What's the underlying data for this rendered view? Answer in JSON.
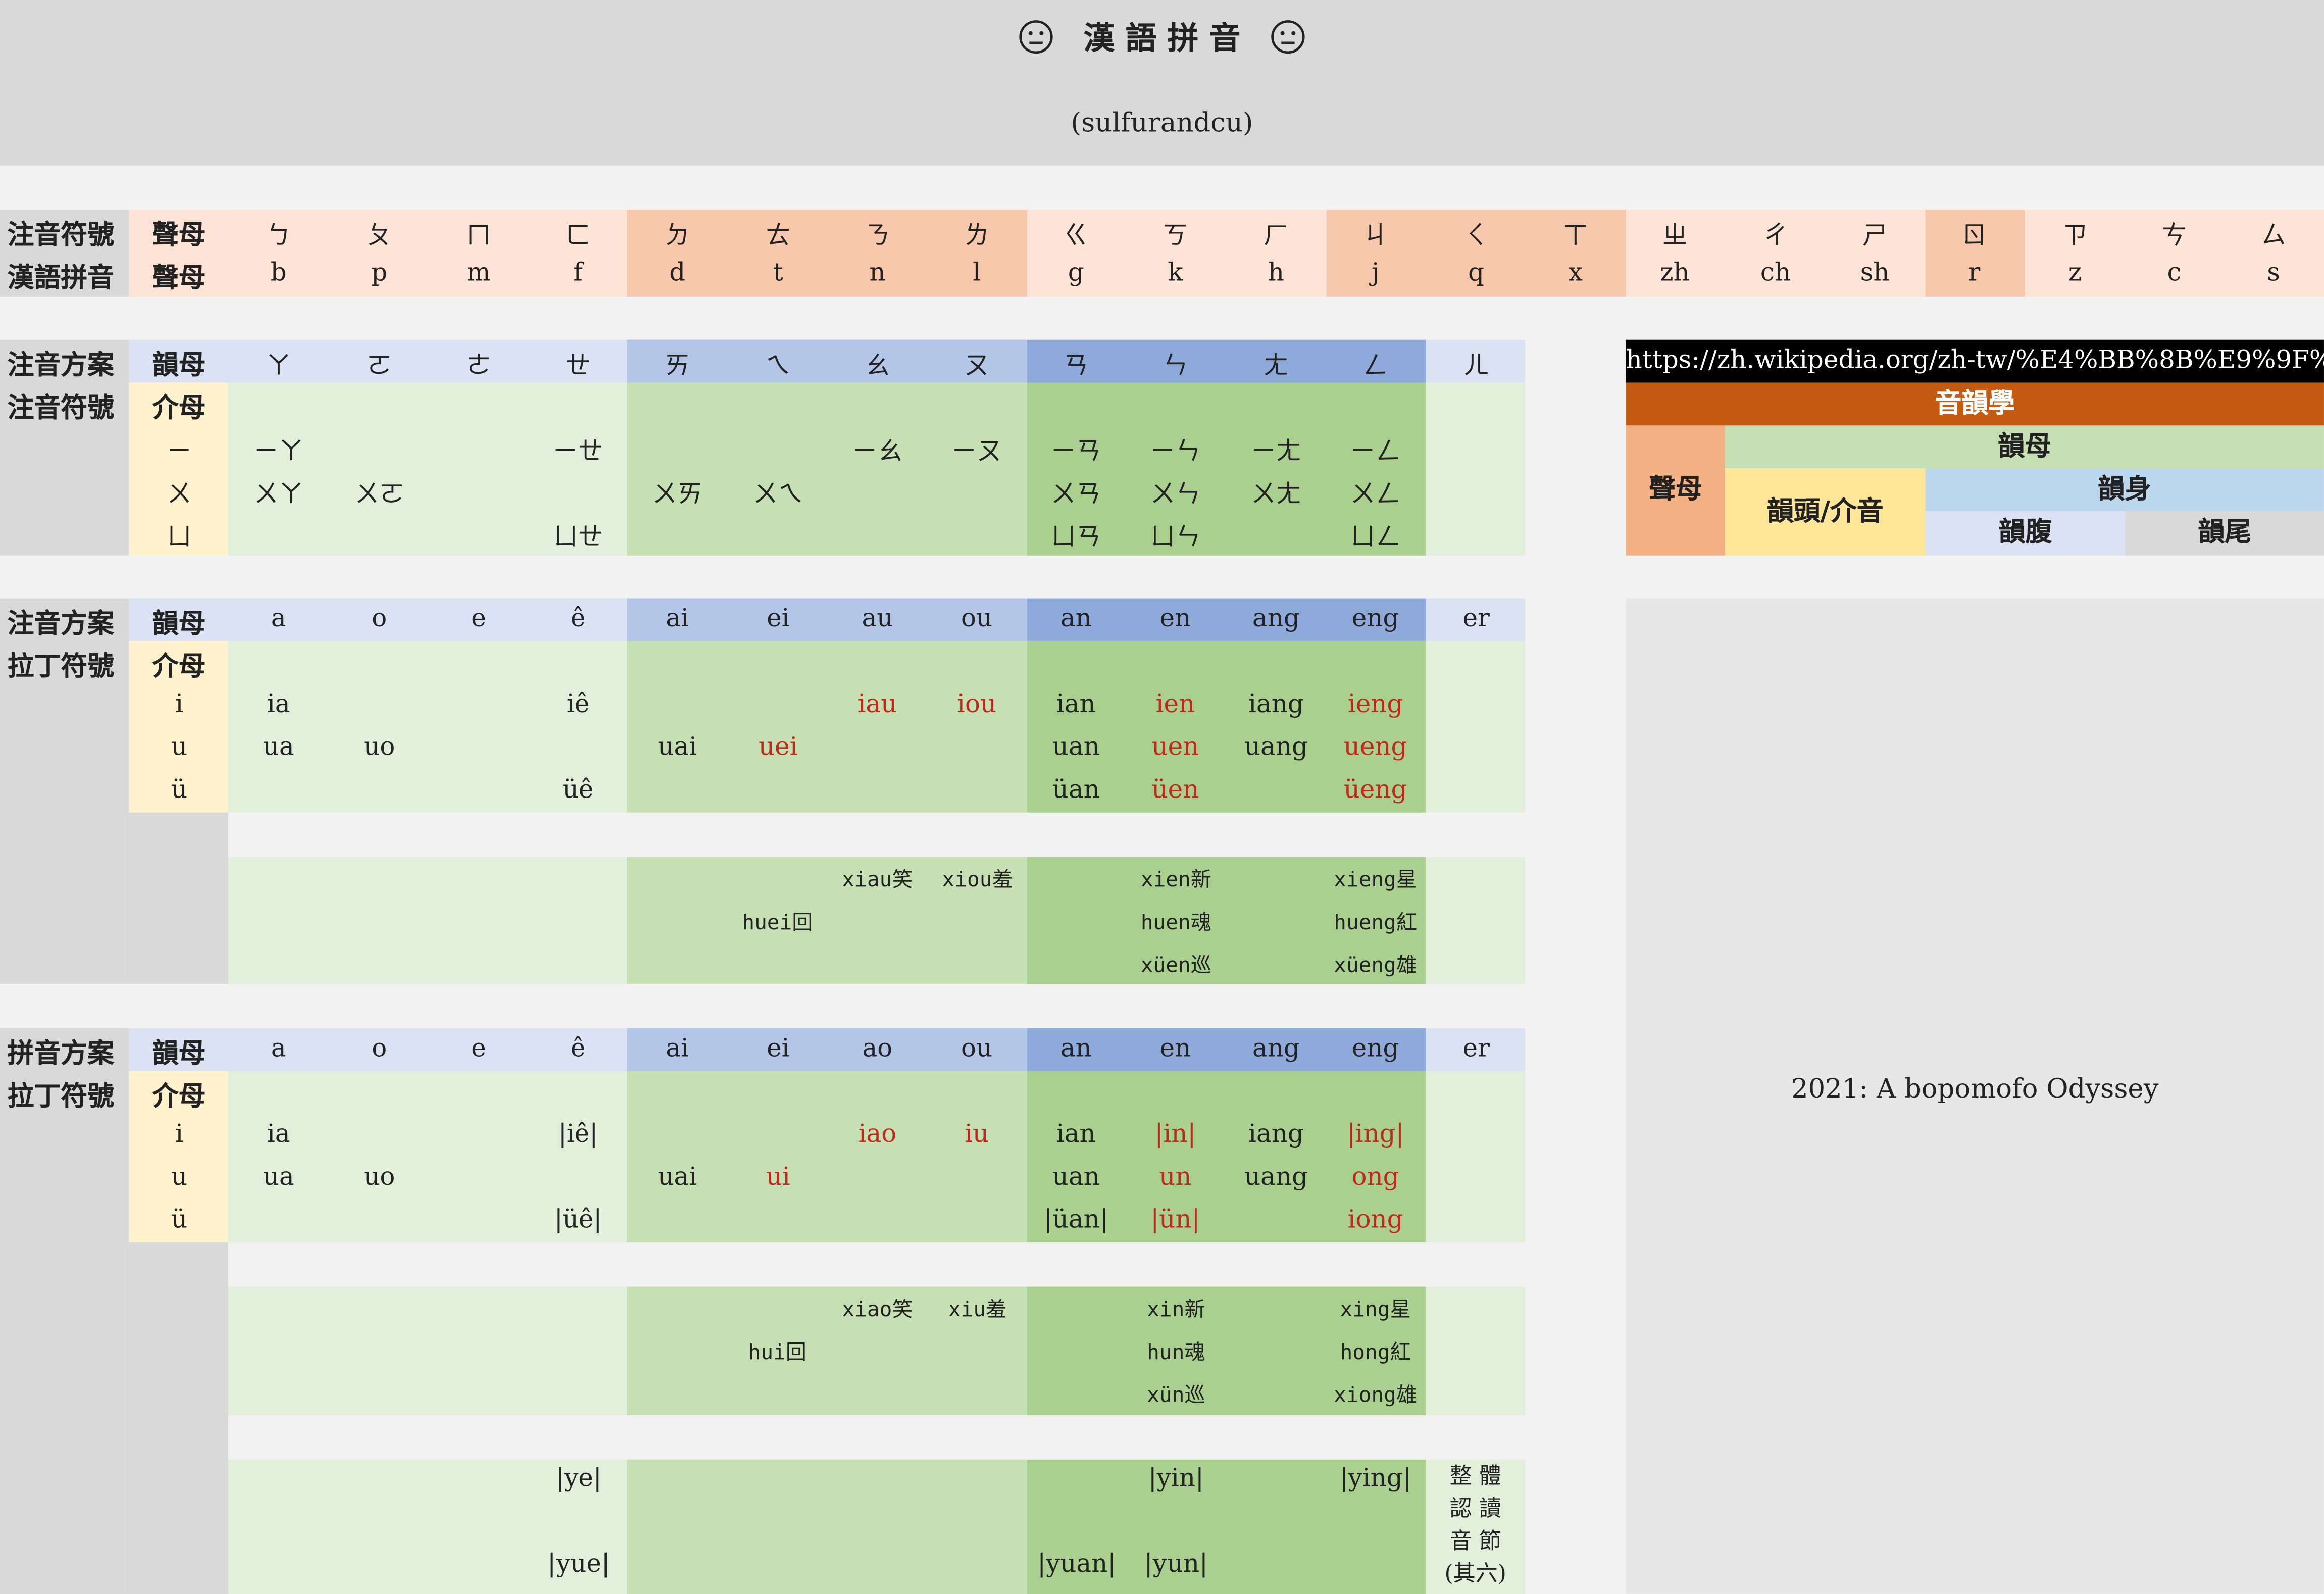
{
  "header": {
    "title": "漢 語 拼 音",
    "subtitle": "(sulfurandcu)",
    "face_icon": "neutral-face-icon"
  },
  "colors": {
    "header_bg": "#d9d9d9",
    "peach": "#fde4d6",
    "peach_dark": "#f8c8ad",
    "blue_light": "#dae2f3",
    "blue_mid": "#b3c6e7",
    "blue_dark": "#8eaadb",
    "green_light": "#e2efda",
    "green_mid": "#c6e0b4",
    "green_dark": "#a9d08e",
    "yellow": "#fff2cc",
    "gray": "#d9d9d9",
    "orange": "#c55a11",
    "black": "#000000",
    "red": "#c0281c"
  },
  "initials": {
    "row1_label": "注音符號",
    "row2_label": "漢語拼音",
    "col_label": "聲母",
    "zhuyin": [
      "ㄅ",
      "ㄆ",
      "ㄇ",
      "ㄈ",
      "ㄉ",
      "ㄊ",
      "ㄋ",
      "ㄌ",
      "ㄍ",
      "ㄎ",
      "ㄏ",
      "ㄐ",
      "ㄑ",
      "ㄒ",
      "ㄓ",
      "ㄔ",
      "ㄕ",
      "ㄖ",
      "ㄗ",
      "ㄘ",
      "ㄙ"
    ],
    "pinyin": [
      "b",
      "p",
      "m",
      "f",
      "d",
      "t",
      "n",
      "l",
      "g",
      "k",
      "h",
      "j",
      "q",
      "x",
      "zh",
      "ch",
      "sh",
      "r",
      "z",
      "c",
      "s"
    ]
  },
  "zhuyin_table": {
    "label1": "注音方案",
    "label2": "注音符號",
    "head_label": "韻母",
    "medial_label": "介母",
    "finals": [
      "ㄚ",
      "ㄛ",
      "ㄜ",
      "ㄝ",
      "ㄞ",
      "ㄟ",
      "ㄠ",
      "ㄡ",
      "ㄢ",
      "ㄣ",
      "ㄤ",
      "ㄥ",
      "ㄦ"
    ],
    "medials": [
      "ㄧ",
      "ㄨ",
      "ㄩ"
    ],
    "rows": [
      [
        "ㄧㄚ",
        "",
        "",
        "ㄧㄝ",
        "",
        "",
        "ㄧㄠ",
        "ㄧㄡ",
        "ㄧㄢ",
        "ㄧㄣ",
        "ㄧㄤ",
        "ㄧㄥ",
        ""
      ],
      [
        "ㄨㄚ",
        "ㄨㄛ",
        "",
        "",
        "ㄨㄞ",
        "ㄨㄟ",
        "",
        "",
        "ㄨㄢ",
        "ㄨㄣ",
        "ㄨㄤ",
        "ㄨㄥ",
        ""
      ],
      [
        "",
        "",
        "",
        "ㄩㄝ",
        "",
        "",
        "",
        "",
        "ㄩㄢ",
        "ㄩㄣ",
        "",
        "ㄩㄥ",
        ""
      ]
    ]
  },
  "zhuyin_latin": {
    "label1": "注音方案",
    "label2": "拉丁符號",
    "head_label": "韻母",
    "medial_label": "介母",
    "finals": [
      "a",
      "o",
      "e",
      "ê",
      "ai",
      "ei",
      "au",
      "ou",
      "an",
      "en",
      "ang",
      "eng",
      "er"
    ],
    "medials": [
      "i",
      "u",
      "ü"
    ],
    "rows": [
      [
        "ia",
        "",
        "",
        "iê",
        "",
        "",
        "iau",
        "iou",
        "ian",
        "ien",
        "iang",
        "ieng",
        ""
      ],
      [
        "ua",
        "uo",
        "",
        "",
        "uai",
        "uei",
        "",
        "",
        "uan",
        "uen",
        "uang",
        "ueng",
        ""
      ],
      [
        "",
        "",
        "",
        "üê",
        "",
        "",
        "",
        "",
        "üan",
        "üen",
        "",
        "üeng",
        ""
      ]
    ],
    "examples": {
      "xiau": "xiau笑",
      "xiou": "xiou羞",
      "huei": "huei回",
      "xien": "xien新",
      "huen": "huen魂",
      "xuen": "xüen巡",
      "xieng": "xieng星",
      "hueng": "hueng紅",
      "xueng": "xüeng雄"
    }
  },
  "pinyin_latin": {
    "label1": "拼音方案",
    "label2": "拉丁符號",
    "head_label": "韻母",
    "medial_label": "介母",
    "finals": [
      "a",
      "o",
      "e",
      "ê",
      "ai",
      "ei",
      "ao",
      "ou",
      "an",
      "en",
      "ang",
      "eng",
      "er"
    ],
    "medials": [
      "i",
      "u",
      "ü"
    ],
    "rows": [
      [
        "ia",
        "",
        "",
        "|iê|",
        "",
        "",
        "iao",
        "iu",
        "ian",
        "|in|",
        "iang",
        "|ing|",
        ""
      ],
      [
        "ua",
        "uo",
        "",
        "",
        "uai",
        "ui",
        "",
        "",
        "uan",
        "un",
        "uang",
        "ong",
        ""
      ],
      [
        "",
        "",
        "",
        "|üê|",
        "",
        "",
        "",
        "",
        "|üan|",
        "|ün|",
        "",
        "iong",
        ""
      ]
    ],
    "examples": {
      "xiao": "xiao笑",
      "xiu": "xiu羞",
      "hui": "hui回",
      "xin": "xin新",
      "hun": "hun魂",
      "xun": "xün巡",
      "xing": "xing星",
      "hong": "hong紅",
      "xiong": "xiong雄"
    },
    "syllables": {
      "ye": "|ye|",
      "yue": "|yue|",
      "yin": "|yin|",
      "ying": "|ying|",
      "yuan": "|yuan|",
      "yun": "|yun|"
    },
    "note": [
      "整",
      "體",
      "認",
      "讀",
      "音",
      "節",
      "(其",
      "六)"
    ]
  },
  "legend": {
    "url": "https://zh.wikipedia.org/zh-tw/%E4%BB%8B%E9%9F%B3",
    "top": "音韻學",
    "initial": "聲母",
    "final": "韻母",
    "medial": "韻頭/介音",
    "body": "韻身",
    "nucleus": "韻腹",
    "coda": "韻尾"
  },
  "odyssey": "2021: A bopomofo Odyssey"
}
